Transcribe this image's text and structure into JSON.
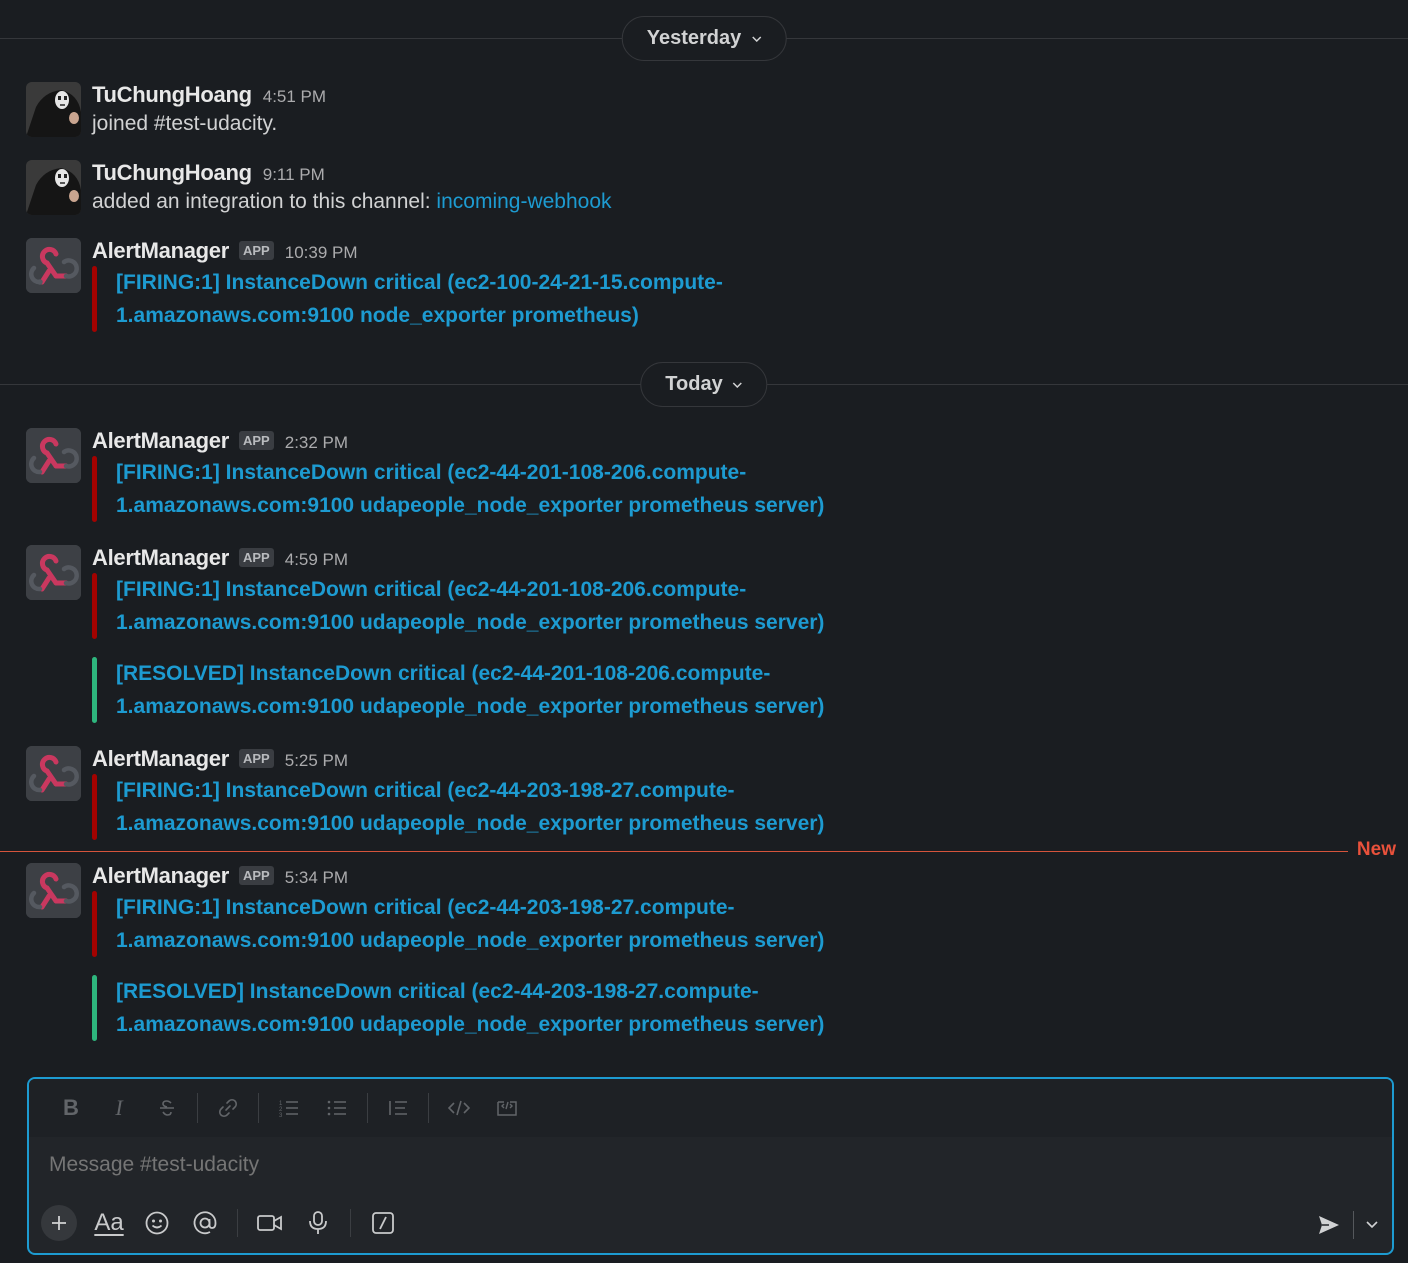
{
  "dividers": {
    "yesterday": "Yesterday",
    "today": "Today"
  },
  "messages": [
    {
      "author": "TuChungHoang",
      "time": "4:51 PM",
      "text": "joined #test-udacity."
    },
    {
      "author": "TuChungHoang",
      "time": "9:11 PM",
      "text": "added an integration to this channel: ",
      "link": "incoming-webhook"
    },
    {
      "author": "AlertManager",
      "badge": "APP",
      "time": "10:39 PM",
      "alerts": [
        {
          "status": "firing",
          "line1": "[FIRING:1] InstanceDown critical (ec2-100-24-21-15.compute-",
          "line2": "1.amazonaws.com:9100 node_exporter prometheus)"
        }
      ]
    },
    {
      "author": "AlertManager",
      "badge": "APP",
      "time": "2:32 PM",
      "alerts": [
        {
          "status": "firing",
          "line1": "[FIRING:1] InstanceDown critical (ec2-44-201-108-206.compute-",
          "line2": "1.amazonaws.com:9100 udapeople_node_exporter prometheus server)"
        }
      ]
    },
    {
      "author": "AlertManager",
      "badge": "APP",
      "time": "4:59 PM",
      "alerts": [
        {
          "status": "firing",
          "line1": "[FIRING:1] InstanceDown critical (ec2-44-201-108-206.compute-",
          "line2": "1.amazonaws.com:9100 udapeople_node_exporter prometheus server)"
        },
        {
          "status": "resolved",
          "line1": "[RESOLVED] InstanceDown critical (ec2-44-201-108-206.compute-",
          "line2": "1.amazonaws.com:9100 udapeople_node_exporter prometheus server)"
        }
      ]
    },
    {
      "author": "AlertManager",
      "badge": "APP",
      "time": "5:25 PM",
      "alerts": [
        {
          "status": "firing",
          "line1": "[FIRING:1] InstanceDown critical (ec2-44-203-198-27.compute-",
          "line2": "1.amazonaws.com:9100 udapeople_node_exporter prometheus server)"
        }
      ]
    },
    {
      "author": "AlertManager",
      "badge": "APP",
      "time": "5:34 PM",
      "alerts": [
        {
          "status": "firing",
          "line1": "[FIRING:1] InstanceDown critical (ec2-44-203-198-27.compute-",
          "line2": "1.amazonaws.com:9100 udapeople_node_exporter prometheus server)"
        },
        {
          "status": "resolved",
          "line1": "[RESOLVED] InstanceDown critical (ec2-44-203-198-27.compute-",
          "line2": "1.amazonaws.com:9100 udapeople_node_exporter prometheus server)"
        }
      ]
    }
  ],
  "new_marker": "New",
  "composer": {
    "placeholder": "Message #test-udacity",
    "format_icons": [
      "bold-icon",
      "italic-icon",
      "strikethrough-icon",
      "link-icon",
      "ordered-list-icon",
      "bulleted-list-icon",
      "blockquote-icon",
      "code-icon",
      "code-block-icon"
    ],
    "action_icons": [
      "plus-icon",
      "formatting-icon",
      "emoji-icon",
      "mention-icon",
      "video-icon",
      "microphone-icon",
      "shortcuts-icon"
    ],
    "aa_label": "Aa"
  },
  "colors": {
    "background": "#1a1d21",
    "link": "#1d9bd1",
    "firing_bar": "#a30200",
    "resolved_bar": "#2eb67d",
    "new_marker": "#e9513b"
  }
}
